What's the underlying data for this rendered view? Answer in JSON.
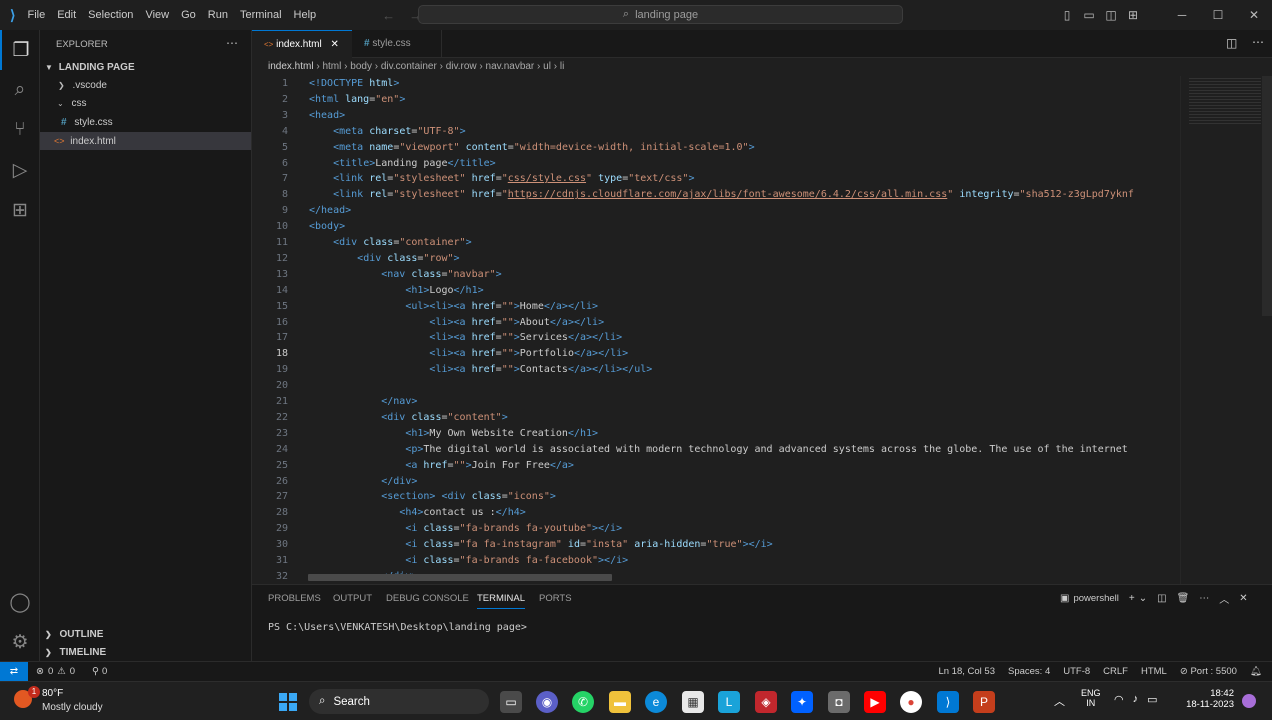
{
  "titlebar": {
    "menu": [
      "File",
      "Edit",
      "Selection",
      "View",
      "Go",
      "Run",
      "Terminal",
      "Help"
    ],
    "search": "landing page"
  },
  "sidebar": {
    "title": "EXPLORER",
    "project": "LANDING PAGE",
    "tree": [
      {
        "label": ".vscode",
        "type": "folder",
        "depth": 1,
        "open": false
      },
      {
        "label": "css",
        "type": "folder",
        "depth": 1,
        "open": true
      },
      {
        "label": "style.css",
        "type": "css",
        "depth": 2
      },
      {
        "label": "index.html",
        "type": "html",
        "depth": 1,
        "selected": true
      }
    ],
    "outline": "OUTLINE",
    "timeline": "TIMELINE"
  },
  "tabs": [
    {
      "label": "index.html",
      "active": true
    },
    {
      "label": "style.css",
      "active": false
    }
  ],
  "breadcrumb": [
    "index.html",
    "html",
    "body",
    "div.container",
    "div.row",
    "nav.navbar",
    "ul",
    "li"
  ],
  "editor": {
    "current_line": 18,
    "lines": [
      [
        [
          "<!DOCTYPE ",
          "t"
        ],
        [
          "html",
          "a"
        ],
        [
          ">",
          "t"
        ]
      ],
      [
        [
          "<html ",
          "t"
        ],
        [
          "lang",
          "a"
        ],
        [
          "=",
          "w"
        ],
        [
          "\"en\"",
          "s"
        ],
        [
          ">",
          "t"
        ]
      ],
      [
        [
          "<head>",
          "t"
        ]
      ],
      [
        [
          "    ",
          "w"
        ],
        [
          "<meta ",
          "t"
        ],
        [
          "charset",
          "a"
        ],
        [
          "=",
          "w"
        ],
        [
          "\"UTF-8\"",
          "s"
        ],
        [
          ">",
          "t"
        ]
      ],
      [
        [
          "    ",
          "w"
        ],
        [
          "<meta ",
          "t"
        ],
        [
          "name",
          "a"
        ],
        [
          "=",
          "w"
        ],
        [
          "\"viewport\"",
          "s"
        ],
        [
          " ",
          "w"
        ],
        [
          "content",
          "a"
        ],
        [
          "=",
          "w"
        ],
        [
          "\"width=device-width, initial-scale=1.0\"",
          "s"
        ],
        [
          ">",
          "t"
        ]
      ],
      [
        [
          "    ",
          "w"
        ],
        [
          "<title>",
          "t"
        ],
        [
          "Landing page",
          "w"
        ],
        [
          "</title>",
          "t"
        ]
      ],
      [
        [
          "    ",
          "w"
        ],
        [
          "<link ",
          "t"
        ],
        [
          "rel",
          "a"
        ],
        [
          "=",
          "w"
        ],
        [
          "\"stylesheet\"",
          "s"
        ],
        [
          " ",
          "w"
        ],
        [
          "href",
          "a"
        ],
        [
          "=",
          "w"
        ],
        [
          "\"",
          "s"
        ],
        [
          "css/style.css",
          "u"
        ],
        [
          "\"",
          "s"
        ],
        [
          " ",
          "w"
        ],
        [
          "type",
          "a"
        ],
        [
          "=",
          "w"
        ],
        [
          "\"text/css\"",
          "s"
        ],
        [
          ">",
          "t"
        ]
      ],
      [
        [
          "    ",
          "w"
        ],
        [
          "<link ",
          "t"
        ],
        [
          "rel",
          "a"
        ],
        [
          "=",
          "w"
        ],
        [
          "\"stylesheet\"",
          "s"
        ],
        [
          " ",
          "w"
        ],
        [
          "href",
          "a"
        ],
        [
          "=",
          "w"
        ],
        [
          "\"",
          "s"
        ],
        [
          "https://cdnjs.cloudflare.com/ajax/libs/font-awesome/6.4.2/css/all.min.css",
          "u"
        ],
        [
          "\"",
          "s"
        ],
        [
          " ",
          "w"
        ],
        [
          "integrity",
          "a"
        ],
        [
          "=",
          "w"
        ],
        [
          "\"sha512-z3gLpd7yknf",
          "s"
        ]
      ],
      [
        [
          "</head>",
          "t"
        ]
      ],
      [
        [
          "<body>",
          "t"
        ]
      ],
      [
        [
          "    ",
          "w"
        ],
        [
          "<div ",
          "t"
        ],
        [
          "class",
          "a"
        ],
        [
          "=",
          "w"
        ],
        [
          "\"container\"",
          "s"
        ],
        [
          ">",
          "t"
        ]
      ],
      [
        [
          "        ",
          "w"
        ],
        [
          "<div ",
          "t"
        ],
        [
          "class",
          "a"
        ],
        [
          "=",
          "w"
        ],
        [
          "\"row\"",
          "s"
        ],
        [
          ">",
          "t"
        ]
      ],
      [
        [
          "            ",
          "w"
        ],
        [
          "<nav ",
          "t"
        ],
        [
          "class",
          "a"
        ],
        [
          "=",
          "w"
        ],
        [
          "\"navbar\"",
          "s"
        ],
        [
          ">",
          "t"
        ]
      ],
      [
        [
          "                ",
          "w"
        ],
        [
          "<h1>",
          "t"
        ],
        [
          "Logo",
          "w"
        ],
        [
          "</h1>",
          "t"
        ]
      ],
      [
        [
          "                ",
          "w"
        ],
        [
          "<ul>",
          "t"
        ],
        [
          "<li>",
          "t"
        ],
        [
          "<a ",
          "t"
        ],
        [
          "href",
          "a"
        ],
        [
          "=",
          "w"
        ],
        [
          "\"\"",
          "s"
        ],
        [
          ">",
          "t"
        ],
        [
          "Home",
          "w"
        ],
        [
          "</a>",
          "t"
        ],
        [
          "</li>",
          "t"
        ]
      ],
      [
        [
          "                    ",
          "w"
        ],
        [
          "<li>",
          "t"
        ],
        [
          "<a ",
          "t"
        ],
        [
          "href",
          "a"
        ],
        [
          "=",
          "w"
        ],
        [
          "\"\"",
          "s"
        ],
        [
          ">",
          "t"
        ],
        [
          "About",
          "w"
        ],
        [
          "</a>",
          "t"
        ],
        [
          "</li>",
          "t"
        ]
      ],
      [
        [
          "                    ",
          "w"
        ],
        [
          "<li>",
          "t"
        ],
        [
          "<a ",
          "t"
        ],
        [
          "href",
          "a"
        ],
        [
          "=",
          "w"
        ],
        [
          "\"\"",
          "s"
        ],
        [
          ">",
          "t"
        ],
        [
          "Services",
          "w"
        ],
        [
          "</a>",
          "t"
        ],
        [
          "</li>",
          "t"
        ]
      ],
      [
        [
          "                    ",
          "w"
        ],
        [
          "<li>",
          "t"
        ],
        [
          "<a ",
          "t"
        ],
        [
          "href",
          "a"
        ],
        [
          "=",
          "w"
        ],
        [
          "\"\"",
          "s"
        ],
        [
          ">",
          "t"
        ],
        [
          "Portfolio",
          "w"
        ],
        [
          "</a>",
          "t"
        ],
        [
          "</li>",
          "t"
        ]
      ],
      [
        [
          "                    ",
          "w"
        ],
        [
          "<li>",
          "t"
        ],
        [
          "<a ",
          "t"
        ],
        [
          "href",
          "a"
        ],
        [
          "=",
          "w"
        ],
        [
          "\"\"",
          "s"
        ],
        [
          ">",
          "t"
        ],
        [
          "Contacts",
          "w"
        ],
        [
          "</a>",
          "t"
        ],
        [
          "</li>",
          "t"
        ],
        [
          "</ul>",
          "t"
        ]
      ],
      [
        [
          "",
          "w"
        ]
      ],
      [
        [
          "            ",
          "w"
        ],
        [
          "</nav>",
          "t"
        ]
      ],
      [
        [
          "            ",
          "w"
        ],
        [
          "<div ",
          "t"
        ],
        [
          "class",
          "a"
        ],
        [
          "=",
          "w"
        ],
        [
          "\"content\"",
          "s"
        ],
        [
          ">",
          "t"
        ]
      ],
      [
        [
          "                ",
          "w"
        ],
        [
          "<h1>",
          "t"
        ],
        [
          "My Own Website Creation",
          "w"
        ],
        [
          "</h1>",
          "t"
        ]
      ],
      [
        [
          "                ",
          "w"
        ],
        [
          "<p>",
          "t"
        ],
        [
          "The digital world is associated with modern technology and advanced systems across the globe. The use of the internet",
          "w"
        ]
      ],
      [
        [
          "                ",
          "w"
        ],
        [
          "<a ",
          "t"
        ],
        [
          "href",
          "a"
        ],
        [
          "=",
          "w"
        ],
        [
          "\"\"",
          "s"
        ],
        [
          ">",
          "t"
        ],
        [
          "Join For Free",
          "w"
        ],
        [
          "</a>",
          "t"
        ]
      ],
      [
        [
          "            ",
          "w"
        ],
        [
          "</div>",
          "t"
        ]
      ],
      [
        [
          "            ",
          "w"
        ],
        [
          "<section>",
          "t"
        ],
        [
          " ",
          "w"
        ],
        [
          "<div ",
          "t"
        ],
        [
          "class",
          "a"
        ],
        [
          "=",
          "w"
        ],
        [
          "\"icons\"",
          "s"
        ],
        [
          ">",
          "t"
        ]
      ],
      [
        [
          "               ",
          "w"
        ],
        [
          "<h4>",
          "t"
        ],
        [
          "contact us :",
          "w"
        ],
        [
          "</h4>",
          "t"
        ]
      ],
      [
        [
          "                ",
          "w"
        ],
        [
          "<i ",
          "t"
        ],
        [
          "class",
          "a"
        ],
        [
          "=",
          "w"
        ],
        [
          "\"fa-brands fa-youtube\"",
          "s"
        ],
        [
          ">",
          "t"
        ],
        [
          "</i>",
          "t"
        ]
      ],
      [
        [
          "                ",
          "w"
        ],
        [
          "<i ",
          "t"
        ],
        [
          "class",
          "a"
        ],
        [
          "=",
          "w"
        ],
        [
          "\"fa fa-instagram\"",
          "s"
        ],
        [
          " ",
          "w"
        ],
        [
          "id",
          "a"
        ],
        [
          "=",
          "w"
        ],
        [
          "\"insta\"",
          "s"
        ],
        [
          " ",
          "w"
        ],
        [
          "aria-hidden",
          "a"
        ],
        [
          "=",
          "w"
        ],
        [
          "\"true\"",
          "s"
        ],
        [
          ">",
          "t"
        ],
        [
          "</i>",
          "t"
        ]
      ],
      [
        [
          "                ",
          "w"
        ],
        [
          "<i ",
          "t"
        ],
        [
          "class",
          "a"
        ],
        [
          "=",
          "w"
        ],
        [
          "\"fa-brands fa-facebook\"",
          "s"
        ],
        [
          ">",
          "t"
        ],
        [
          "</i>",
          "t"
        ]
      ],
      [
        [
          "            ",
          "w"
        ],
        [
          "</div>",
          "t"
        ]
      ]
    ]
  },
  "panel": {
    "tabs": [
      "PROBLEMS",
      "OUTPUT",
      "DEBUG CONSOLE",
      "TERMINAL",
      "PORTS"
    ],
    "active_tab": "TERMINAL",
    "shell": "powershell",
    "prompt": "PS C:\\Users\\VENKATESH\\Desktop\\landing page>"
  },
  "status": {
    "errors": "0",
    "warnings": "0",
    "ports_fwd": "0",
    "position": "Ln 18, Col 53",
    "spaces": "Spaces: 4",
    "encoding": "UTF-8",
    "eol": "CRLF",
    "language": "HTML",
    "port": "Port : 5500"
  },
  "taskbar": {
    "weather_temp": "80°F",
    "weather_desc": "Mostly cloudy",
    "weather_badge": "1",
    "search": "Search",
    "lang1": "ENG",
    "lang2": "IN",
    "time": "18:42",
    "date": "18-11-2023"
  },
  "colors": {
    "tag": "#569cd6",
    "attr": "#9cdcfe",
    "string": "#ce9178",
    "text": "#cccccc",
    "accent": "#0078d4"
  }
}
